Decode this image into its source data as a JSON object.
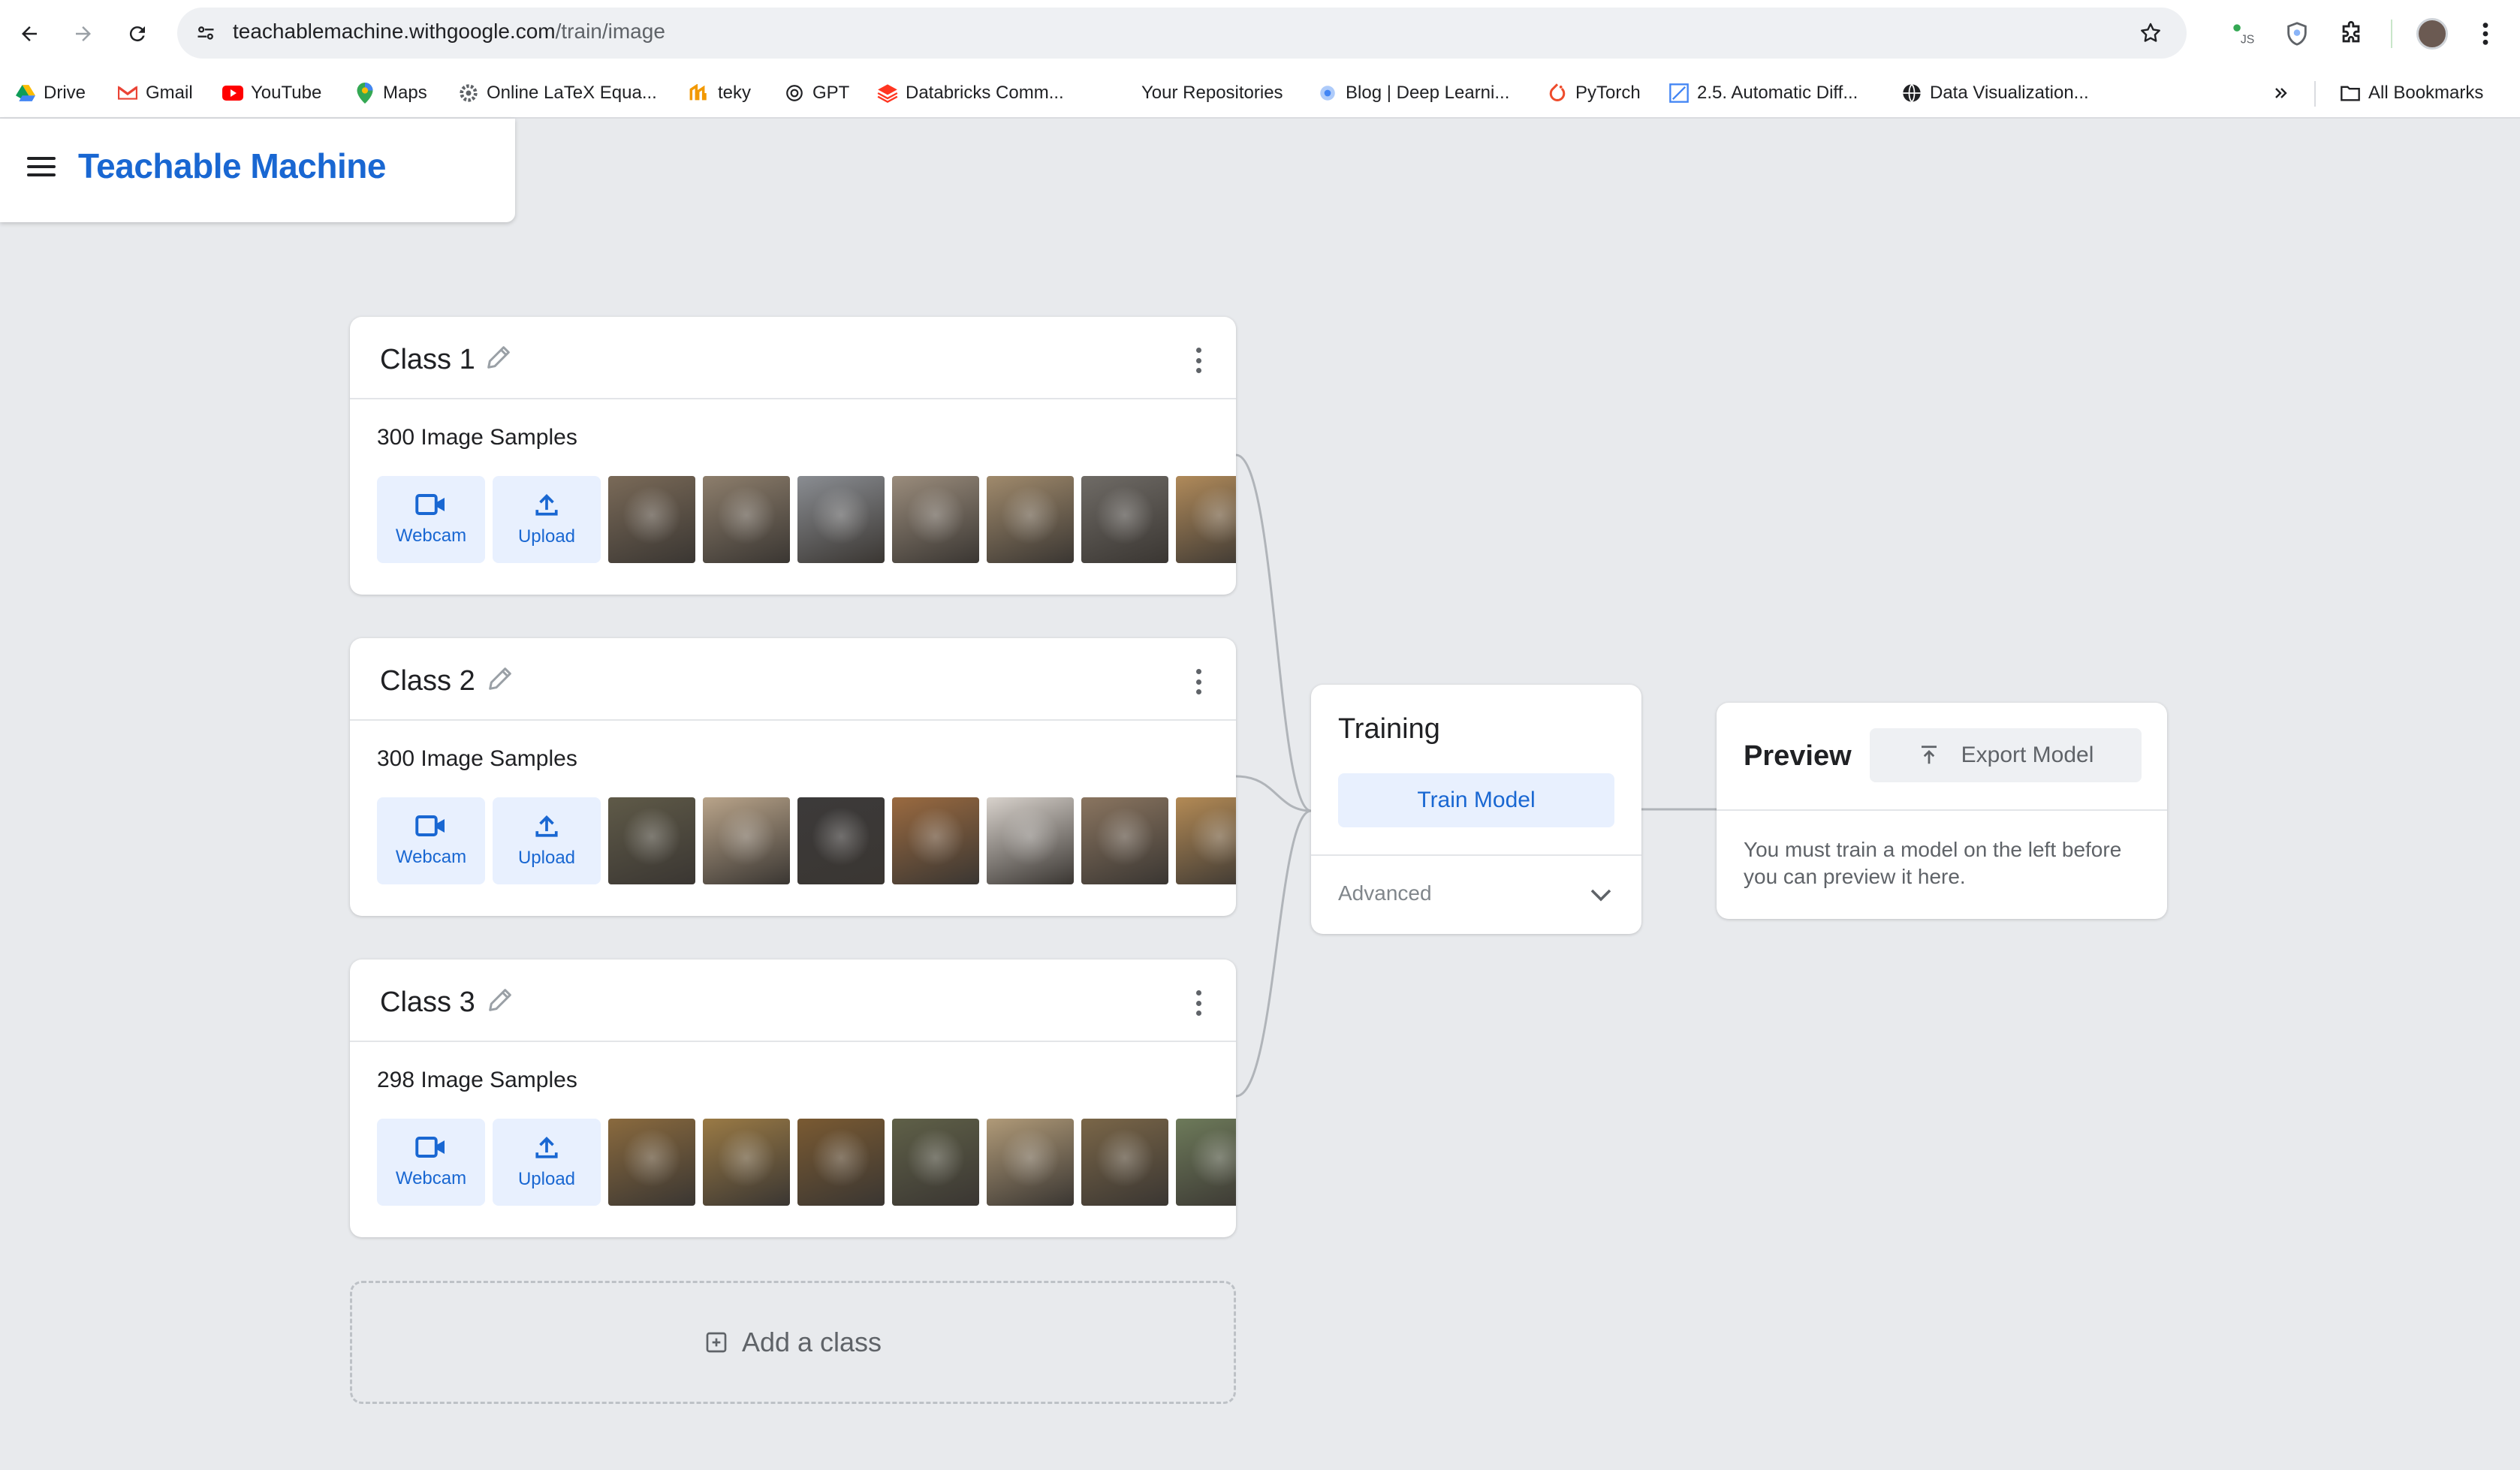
{
  "browser": {
    "url_host": "teachablemachine.withgoogle.com",
    "url_path": "/train/image",
    "bookmarks": [
      {
        "label": "Drive",
        "icon": "google-drive-icon"
      },
      {
        "label": "Gmail",
        "icon": "gmail-icon"
      },
      {
        "label": "YouTube",
        "icon": "youtube-icon"
      },
      {
        "label": "Maps",
        "icon": "google-maps-icon"
      },
      {
        "label": "Online LaTeX Equa...",
        "icon": "gear-icon"
      },
      {
        "label": "teky",
        "icon": "teky-icon"
      },
      {
        "label": "GPT",
        "icon": "openai-icon"
      },
      {
        "label": "Databricks Comm...",
        "icon": "databricks-icon"
      },
      {
        "label": "Your Repositories",
        "icon": ""
      },
      {
        "label": "Blog | Deep Learni...",
        "icon": "blog-icon"
      },
      {
        "label": "PyTorch",
        "icon": "pytorch-icon"
      },
      {
        "label": "2.5. Automatic Diff...",
        "icon": "d2l-icon"
      },
      {
        "label": "Data Visualization...",
        "icon": "globe-icon"
      }
    ],
    "all_bookmarks": "All Bookmarks"
  },
  "app": {
    "title": "Teachable Machine"
  },
  "classes": [
    {
      "name": "Class 1",
      "samples": "300 Image Samples",
      "webcam": "Webcam",
      "upload": "Upload",
      "thumbs": [
        "#7a6a58",
        "#8d7e6c",
        "#8a8d92",
        "#9a8c7c",
        "#a08a6c",
        "#6f6b66",
        "#b08a5a"
      ]
    },
    {
      "name": "Class 2",
      "samples": "300 Image Samples",
      "webcam": "Webcam",
      "upload": "Upload",
      "thumbs": [
        "#5f5a48",
        "#b9a48a",
        "#3c3a3a",
        "#9a6a40",
        "#d8d2cc",
        "#8a7560",
        "#b38a55"
      ]
    },
    {
      "name": "Class 3",
      "samples": "298 Image Samples",
      "webcam": "Webcam",
      "upload": "Upload",
      "thumbs": [
        "#8a6a3e",
        "#9a7a45",
        "#7a5a32",
        "#5f6048",
        "#b09a78",
        "#7a6648",
        "#6d7a5a"
      ]
    }
  ],
  "add_class": "Add a class",
  "training": {
    "title": "Training",
    "train_button": "Train Model",
    "advanced": "Advanced"
  },
  "preview": {
    "title": "Preview",
    "export_button": "Export Model",
    "message": "You must train a model on the left before you can preview it here."
  },
  "colors": {
    "accent": "#1967d2",
    "button_bg": "#e8f0fe",
    "page_bg": "#e8eaed"
  }
}
